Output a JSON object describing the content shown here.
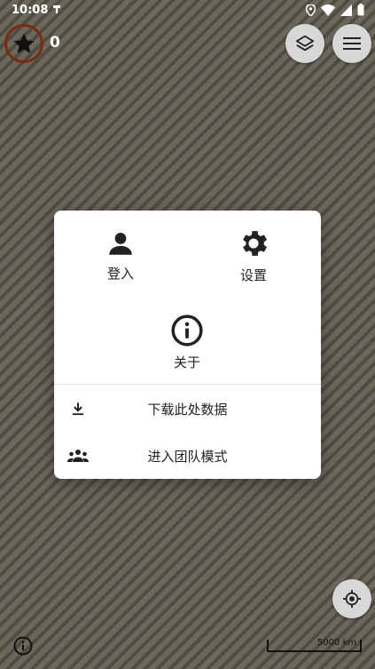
{
  "status": {
    "time": "10:08"
  },
  "map": {
    "star_count": "0",
    "scale_label": "5000 km"
  },
  "dialog": {
    "login_label": "登入",
    "settings_label": "设置",
    "about_label": "关于",
    "download_label": "下载此处数据",
    "team_label": "进入团队模式"
  },
  "icons": [
    "star-icon",
    "layers-icon",
    "menu-icon",
    "locate-icon",
    "info-icon",
    "person-icon",
    "gear-icon",
    "about-info-icon",
    "download-icon",
    "group-icon"
  ]
}
